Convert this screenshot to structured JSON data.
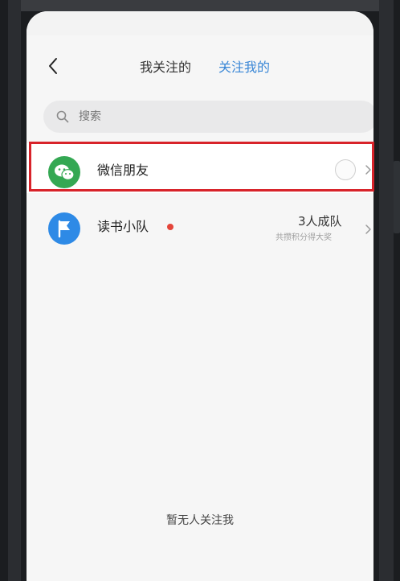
{
  "header": {
    "tabs": [
      {
        "label": "我关注的",
        "active": false
      },
      {
        "label": "关注我的",
        "active": true
      }
    ],
    "active_color": "#3a87d6"
  },
  "search": {
    "placeholder": "搜索"
  },
  "list": {
    "items": [
      {
        "label": "微信朋友",
        "icon": "wechat-icon",
        "icon_color": "#34a853",
        "highlighted": true,
        "highlight_color": "#d8232a"
      },
      {
        "label": "读书小队",
        "icon": "flag-icon",
        "icon_color": "#2e8ae6",
        "badge_color": "#e4453a",
        "count_text": "3人成队",
        "sub_text": "共攒积分得大奖"
      }
    ]
  },
  "empty_state": {
    "text": "暂无人关注我"
  }
}
